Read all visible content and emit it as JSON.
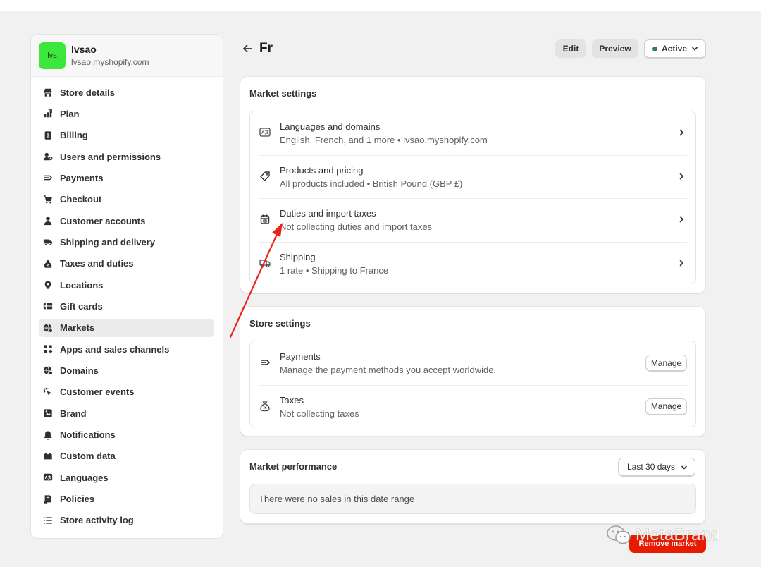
{
  "store": {
    "avatar_initials": "lvs",
    "name": "lvsao",
    "url": "lvsao.myshopify.com"
  },
  "sidebar": {
    "items": [
      {
        "label": "Store details",
        "icon": "store-icon"
      },
      {
        "label": "Plan",
        "icon": "plan-icon"
      },
      {
        "label": "Billing",
        "icon": "billing-icon"
      },
      {
        "label": "Users and permissions",
        "icon": "users-icon"
      },
      {
        "label": "Payments",
        "icon": "payments-icon"
      },
      {
        "label": "Checkout",
        "icon": "cart-icon"
      },
      {
        "label": "Customer accounts",
        "icon": "person-icon"
      },
      {
        "label": "Shipping and delivery",
        "icon": "truck-icon"
      },
      {
        "label": "Taxes and duties",
        "icon": "tax-bag-icon"
      },
      {
        "label": "Locations",
        "icon": "location-pin-icon"
      },
      {
        "label": "Gift cards",
        "icon": "gift-card-icon"
      },
      {
        "label": "Markets",
        "icon": "globe-icon",
        "active": true
      },
      {
        "label": "Apps and sales channels",
        "icon": "apps-icon"
      },
      {
        "label": "Domains",
        "icon": "globe-icon"
      },
      {
        "label": "Customer events",
        "icon": "cursor-click-icon"
      },
      {
        "label": "Brand",
        "icon": "brand-icon"
      },
      {
        "label": "Notifications",
        "icon": "bell-icon"
      },
      {
        "label": "Custom data",
        "icon": "custom-data-icon"
      },
      {
        "label": "Languages",
        "icon": "language-icon"
      },
      {
        "label": "Policies",
        "icon": "policy-icon"
      },
      {
        "label": "Store activity log",
        "icon": "list-icon"
      }
    ]
  },
  "header": {
    "title": "Fr",
    "edit_label": "Edit",
    "preview_label": "Preview",
    "status_label": "Active",
    "status_color": "#29845a"
  },
  "market_settings": {
    "title": "Market settings",
    "rows": [
      {
        "title": "Languages and domains",
        "subtitle": "English, French, and 1 more • lvsao.myshopify.com",
        "icon": "language-icon"
      },
      {
        "title": "Products and pricing",
        "subtitle": "All products included • British Pound (GBP £)",
        "icon": "tag-icon"
      },
      {
        "title": "Duties and import taxes",
        "subtitle": "Not collecting duties and import taxes",
        "icon": "duties-icon"
      },
      {
        "title": "Shipping",
        "subtitle": "1 rate • Shipping to France",
        "icon": "truck-icon"
      }
    ]
  },
  "store_settings": {
    "title": "Store settings",
    "rows": [
      {
        "title": "Payments",
        "subtitle": "Manage the payment methods you accept worldwide.",
        "button": "Manage",
        "icon": "payments-icon"
      },
      {
        "title": "Taxes",
        "subtitle": "Not collecting taxes",
        "button": "Manage",
        "icon": "tax-bag-icon"
      }
    ]
  },
  "market_performance": {
    "title": "Market performance",
    "range_label": "Last 30 days",
    "empty_text": "There were no sales in this date range"
  },
  "footer": {
    "remove_label": "Remove market"
  },
  "watermark": {
    "text": "MetaBrand"
  },
  "colors": {
    "accent_red": "#e51c00",
    "annotation_arrow": "#e8251d",
    "avatar_green": "#3ce63c"
  }
}
